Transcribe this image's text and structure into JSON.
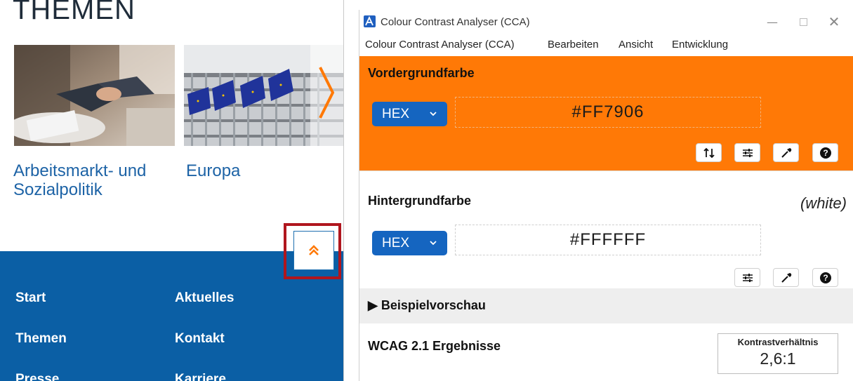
{
  "site": {
    "title": "THEMEN",
    "topics": [
      {
        "label": "Arbeitsmarkt- und Sozialpolitik"
      },
      {
        "label": "Europa"
      }
    ],
    "footer_links": [
      "Start",
      "Aktuelles",
      "Themen",
      "Kontakt",
      "Presse",
      "Karriere"
    ],
    "colors": {
      "footer_bg": "#0b5fa5",
      "link_text": "#1d63a6",
      "accent": "#ff7906",
      "highlight": "#b0161e"
    },
    "scroll_top_icon": "double-chevron-up-icon"
  },
  "cca": {
    "window_title": "Colour Contrast Analyser (CCA)",
    "menu": [
      "Colour Contrast Analyser (CCA)",
      "Bearbeiten",
      "Ansicht",
      "Entwicklung"
    ],
    "foreground": {
      "heading": "Vordergrundfarbe",
      "format": "HEX",
      "value": "#FF7906",
      "panel_color": "#ff7906",
      "tools": [
        "swap-icon",
        "sliders-icon",
        "eyedropper-icon",
        "help-icon"
      ]
    },
    "background": {
      "heading": "Hintergrundfarbe",
      "color_name": "(white)",
      "format": "HEX",
      "value": "#FFFFFF",
      "tools": [
        "sliders-icon",
        "eyedropper-icon",
        "help-icon"
      ]
    },
    "preview": {
      "label": "Beispielvorschau"
    },
    "results": {
      "title": "WCAG 2.1 Ergebnisse",
      "ratio_label": "Kontrastverhältnis",
      "ratio_value": "2,6:1"
    }
  }
}
